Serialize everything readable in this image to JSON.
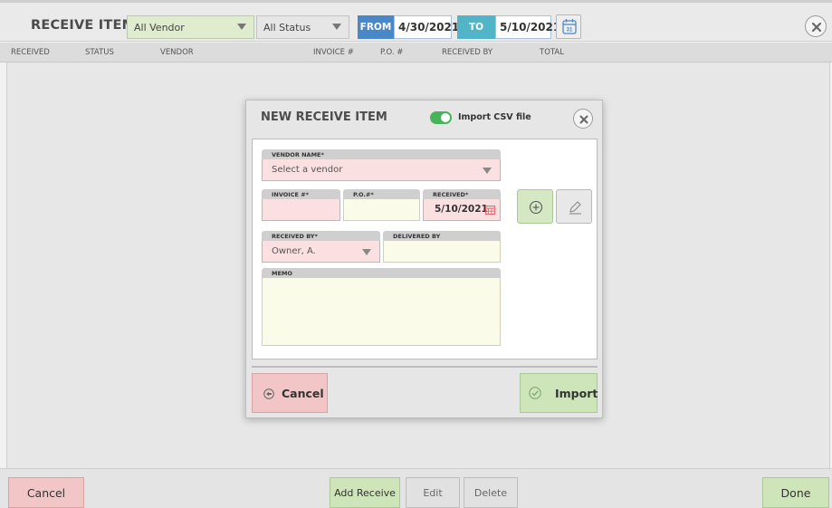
{
  "app": {
    "title": "RECEIVE ITEMS",
    "close_icon": "close-circle-icon"
  },
  "filters": {
    "vendor": "All Vendor",
    "status": "All Status",
    "from_label": "FROM",
    "from_date": "4/30/2021",
    "to_label": "TO",
    "to_date": "5/10/2021",
    "calendar_icon": "calendar-icon",
    "calendar_day": "31"
  },
  "table": {
    "columns": [
      "RECEIVED",
      "STATUS",
      "VENDOR",
      "INVOICE #",
      "P.O. #",
      "RECEIVED BY",
      "TOTAL"
    ],
    "rows": []
  },
  "bottom": {
    "cancel": "Cancel",
    "add_receive": "Add Receive",
    "edit": "Edit",
    "delete": "Delete",
    "done": "Done"
  },
  "modal": {
    "title": "NEW RECEIVE ITEM",
    "import_toggle_label": "Import CSV file",
    "import_toggle_on": true,
    "vendor_label": "VENDOR NAME*",
    "vendor_placeholder": "Select a vendor",
    "invoice_label": "INVOICE #*",
    "invoice_value": "",
    "po_label": "P.O.#*",
    "po_value": "",
    "received_label": "RECEIVED*",
    "received_value": "5/10/2021",
    "received_by_label": "RECEIVED BY*",
    "received_by_value": "Owner, A.",
    "delivered_by_label": "DELIVERED BY",
    "delivered_by_value": "",
    "memo_label": "MEMO",
    "memo_value": "",
    "cancel": "Cancel",
    "import": "Import"
  },
  "colors": {
    "accent_green": "#47b35a",
    "from_blue": "#4a87c6",
    "to_teal": "#52b5c7",
    "cancel_pink": "#f2c6c6",
    "confirm_green": "#cde5b8"
  }
}
